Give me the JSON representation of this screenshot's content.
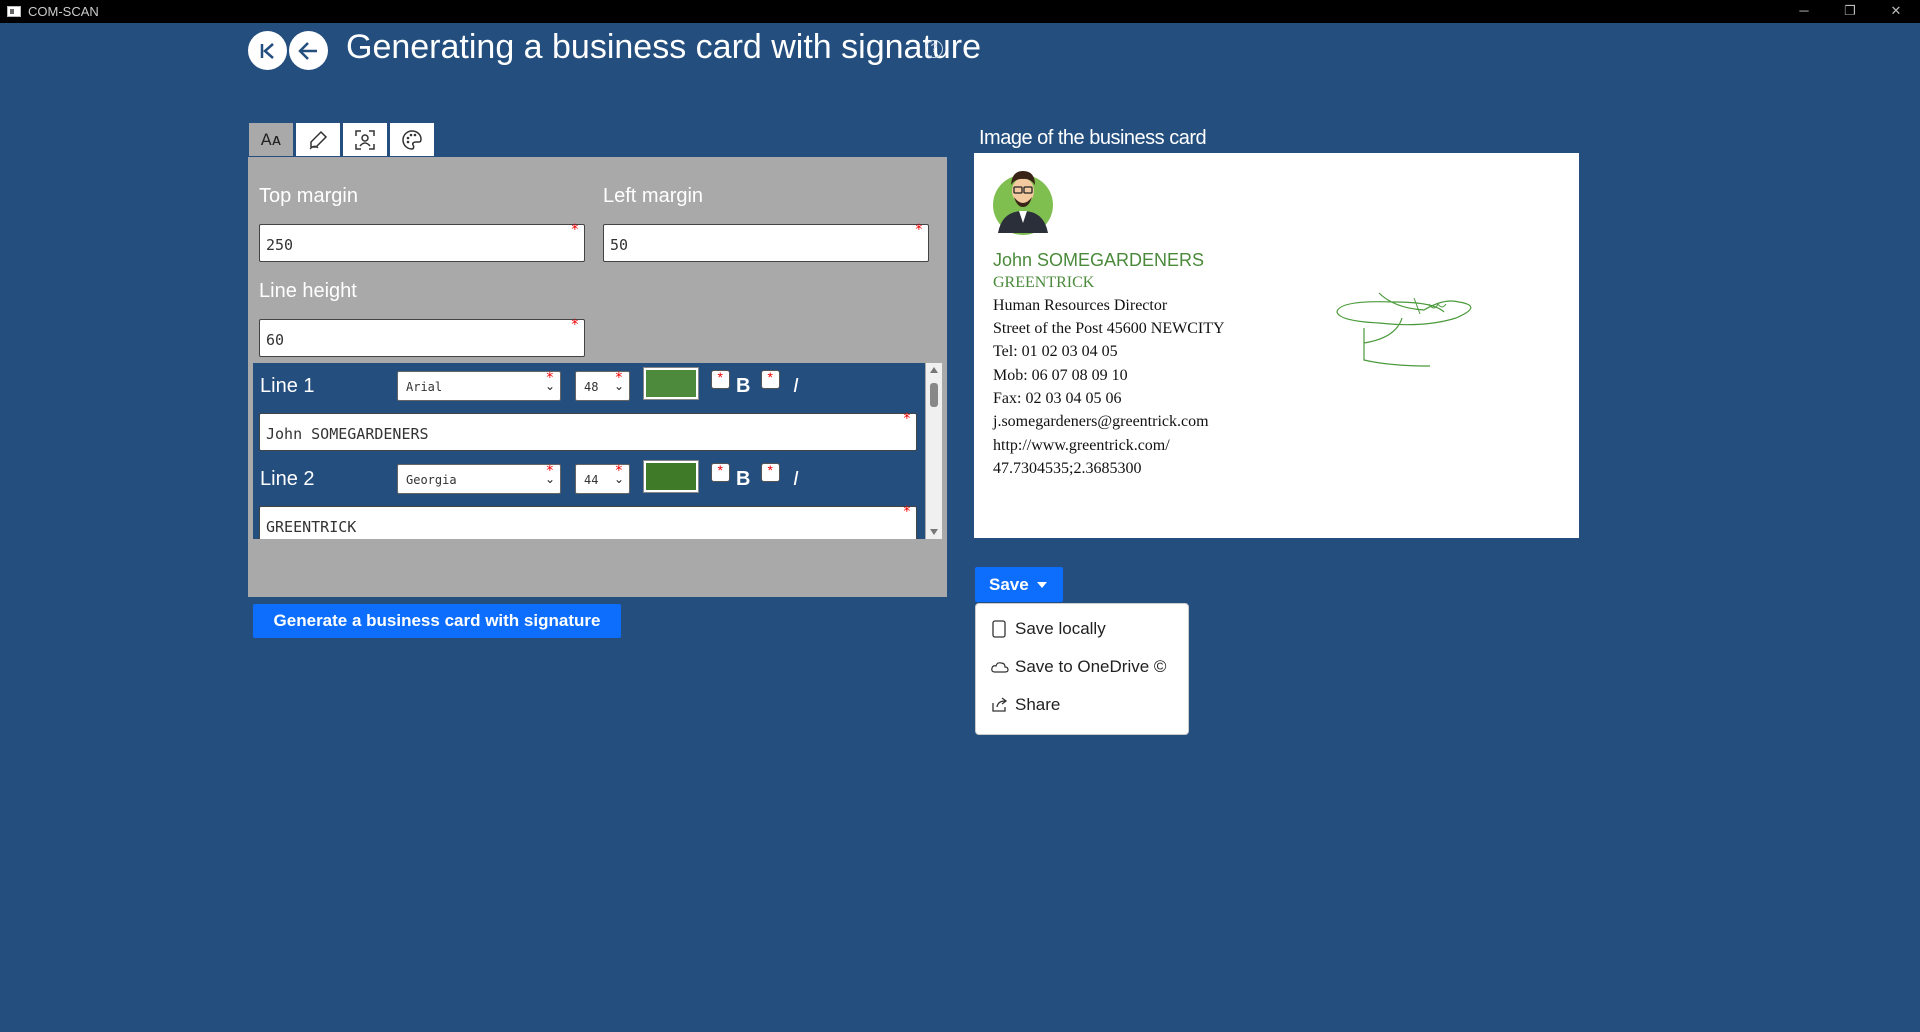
{
  "window": {
    "title": "COM-SCAN",
    "minimize": "─",
    "restore": "❐",
    "close": "✕"
  },
  "header": {
    "title": "Generating a business card with signature",
    "help": "?"
  },
  "tabs": [
    {
      "icon": "font-size-icon",
      "glyph": "Aᴀ"
    },
    {
      "icon": "signature-pen-icon"
    },
    {
      "icon": "face-scan-icon"
    },
    {
      "icon": "palette-icon"
    }
  ],
  "form": {
    "top_margin": {
      "label": "Top margin",
      "value": "250"
    },
    "left_margin": {
      "label": "Left margin",
      "value": "50"
    },
    "line_height": {
      "label": "Line height",
      "value": "60"
    },
    "bold_glyph": "B",
    "italic_glyph": "I",
    "lines": [
      {
        "label": "Line 1",
        "font": "Arial",
        "size": "48",
        "color": "#4e8a3c",
        "text": "John SOMEGARDENERS"
      },
      {
        "label": "Line 2",
        "font": "Georgia",
        "size": "44",
        "color": "#3f7a28",
        "text": "GREENTRICK"
      }
    ],
    "generate_label": "Generate a business card with signature"
  },
  "preview": {
    "label": "Image of the business card",
    "lines": [
      "John SOMEGARDENERS",
      "GREENTRICK",
      "Human Resources Director",
      "Street of the Post 45600 NEWCITY",
      "Tel: 01 02 03 04 05",
      "Mob: 06 07 08 09 10",
      "Fax: 02 03 04 05 06",
      "j.somegardeners@greentrick.com",
      "http://www.greentrick.com/",
      "47.7304535;2.3685300"
    ]
  },
  "save": {
    "label": "Save",
    "menu": [
      {
        "icon": "device-icon",
        "label": "Save locally"
      },
      {
        "icon": "cloud-icon",
        "label": "Save to OneDrive ©"
      },
      {
        "icon": "share-icon",
        "label": "Share"
      }
    ]
  }
}
